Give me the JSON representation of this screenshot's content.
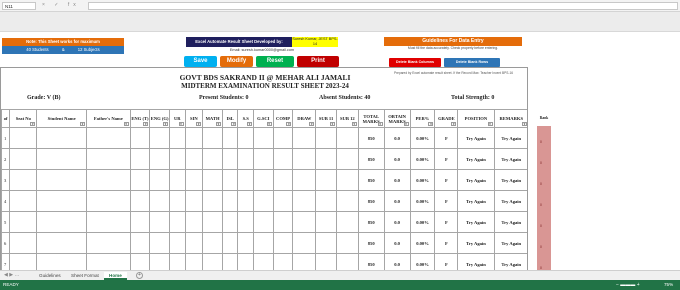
{
  "formula_bar": {
    "name_box": "N11",
    "icons": "× ✓ fx"
  },
  "dashboard": {
    "note_title": "Note: This Sheet works for maximum",
    "note_students": "40 Students",
    "note_and": "&",
    "note_subjects": "12 Subjects",
    "credit_label": "Excel Automate Result Sheet Developed by:",
    "credit_name": "Suresh Kumar, JEST BPS-14",
    "email": "Email: suresh.kumar0000@gmail.com",
    "buttons": {
      "save": "Save",
      "modify": "Modify",
      "reset": "Reset",
      "print": "Print"
    },
    "guidelines_title": "Guidelines For Data Entry",
    "guidelines_text": "Must fill the data accurately. Check properly before entering.",
    "delete_col": "Delete Blank Columns",
    "delete_row": "Delete Blank Rows"
  },
  "report": {
    "small_note": "Prepared by Excel automate result sheet. If the Record Max: Teacher Incent BPS-16",
    "school": "GOVT BDS SAKRAND II @ MEHAR ALI JAMALI",
    "exam": "MIDTERM EXAMINATION RESULT SHEET 2023-24",
    "grade": "Grade: V (B)",
    "present": "Present Students: 0",
    "absent": "Absent Students: 40",
    "strength": "Total Strength: 0",
    "columns": [
      "of",
      "Seat No",
      "Student Name",
      "Father's Name",
      "ENG (T)",
      "ENG (G)",
      "UR",
      "SIN",
      "MATH",
      "ISL",
      "S.S",
      "G.SCI",
      "COMP",
      "DRAW",
      "SUB 11",
      "SUB 12",
      "TOTAL MARKS",
      "OBTAIN MARKS",
      "PER%",
      "GRADE",
      "POSITION",
      "REMARKS"
    ],
    "rows": [
      {
        "no": "1",
        "total": "850",
        "obtain": "0.0",
        "per": "0.00%",
        "grade": "F",
        "position": "Try Again",
        "remarks": "Try Again"
      },
      {
        "no": "2",
        "total": "850",
        "obtain": "0.0",
        "per": "0.00%",
        "grade": "F",
        "position": "Try Again",
        "remarks": "Try Again"
      },
      {
        "no": "3",
        "total": "850",
        "obtain": "0.0",
        "per": "0.00%",
        "grade": "F",
        "position": "Try Again",
        "remarks": "Try Again"
      },
      {
        "no": "4",
        "total": "850",
        "obtain": "0.0",
        "per": "0.00%",
        "grade": "F",
        "position": "Try Again",
        "remarks": "Try Again"
      },
      {
        "no": "5",
        "total": "850",
        "obtain": "0.0",
        "per": "0.00%",
        "grade": "F",
        "position": "Try Again",
        "remarks": "Try Again"
      },
      {
        "no": "6",
        "total": "850",
        "obtain": "0.0",
        "per": "0.00%",
        "grade": "F",
        "position": "Try Again",
        "remarks": "Try Again"
      },
      {
        "no": "7",
        "total": "850",
        "obtain": "0.0",
        "per": "0.00%",
        "grade": "F",
        "position": "Try Again",
        "remarks": "Try Again"
      }
    ]
  },
  "rank_strip": {
    "header": "Rank",
    "values": [
      "0",
      "0",
      "0",
      "0",
      "0",
      "0",
      "0"
    ]
  },
  "tabs": {
    "items": [
      "Guidelines",
      "Sheet Format",
      "Home"
    ],
    "active": "Home",
    "add": "+"
  },
  "status": {
    "ready": "READY",
    "zoom": "75%"
  },
  "colors": {
    "excel_green": "#217346",
    "orange": "#e46c0a",
    "save": "#00b0f0",
    "modify": "#e46c0a",
    "reset": "#00b050",
    "print": "#c00000"
  }
}
